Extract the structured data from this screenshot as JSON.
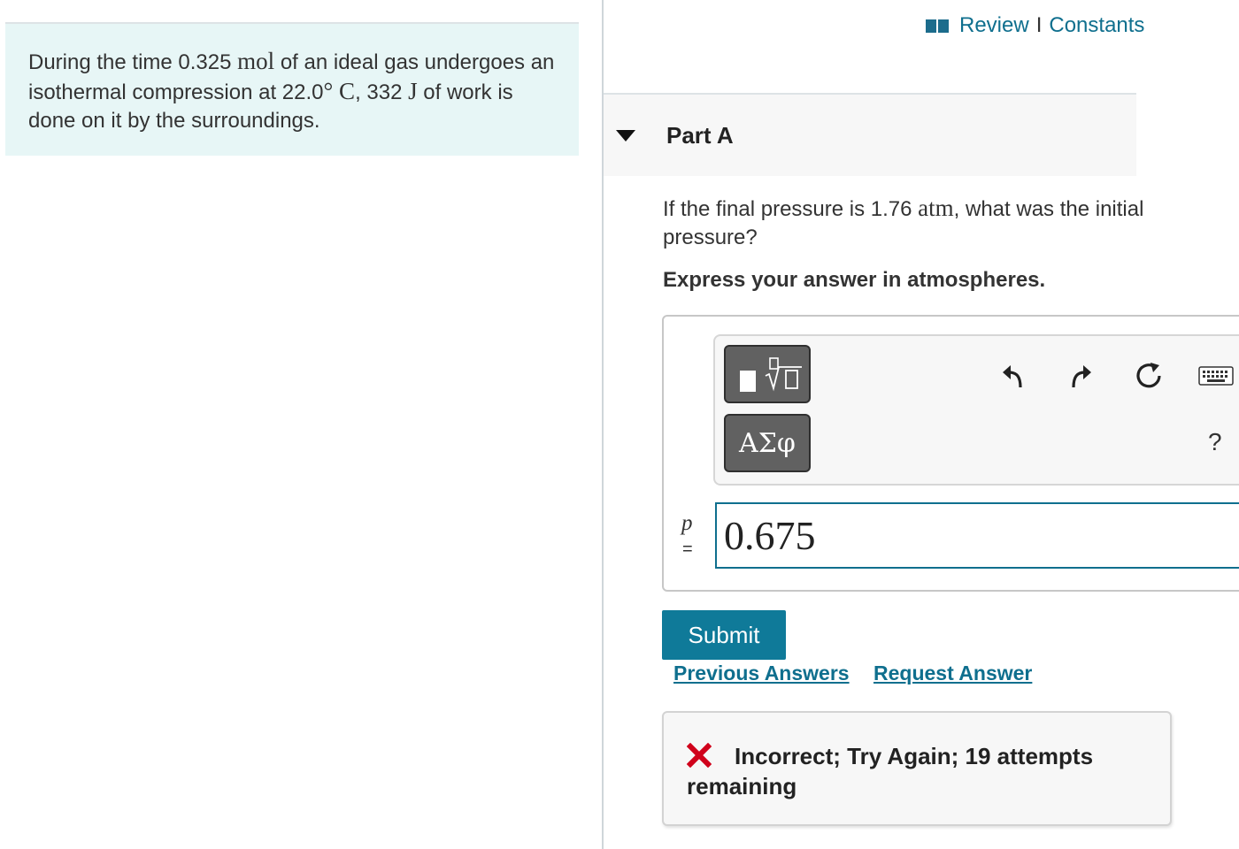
{
  "problem": {
    "seg1": "During the time 0.325 ",
    "unit_mol": "mol",
    "seg2": " of an ideal gas undergoes an isothermal compression at 22.0",
    "unit_degC": "° C",
    "seg3": ", 332 ",
    "unit_J": "J",
    "seg4": " of work is done on it by the surroundings."
  },
  "header": {
    "review_label": "Review",
    "separator": "I",
    "constants_label": "Constants"
  },
  "part": {
    "title": "Part A",
    "question_pre": "If the final pressure is 1.76 ",
    "question_unit": "atm",
    "question_post": ", what was the initial pressure?",
    "instruction": "Express your answer in atmospheres."
  },
  "toolbar": {
    "symbols_label": "ΑΣφ",
    "help_label": "?",
    "icons": [
      "templates-icon",
      "undo-icon",
      "redo-icon",
      "reset-icon",
      "keyboard-icon"
    ]
  },
  "answer": {
    "variable": "p",
    "equals": "=",
    "value": "0.675"
  },
  "actions": {
    "submit_label": "Submit",
    "previous_answers_label": "Previous Answers",
    "request_answer_label": "Request Answer"
  },
  "feedback": {
    "message": "Incorrect; Try Again; 19 attempts remaining",
    "status_color": "#d0021b"
  },
  "colors": {
    "accent": "#0f6f8e",
    "submit_bg": "#0f7a99",
    "problem_bg": "#e7f6f6"
  }
}
